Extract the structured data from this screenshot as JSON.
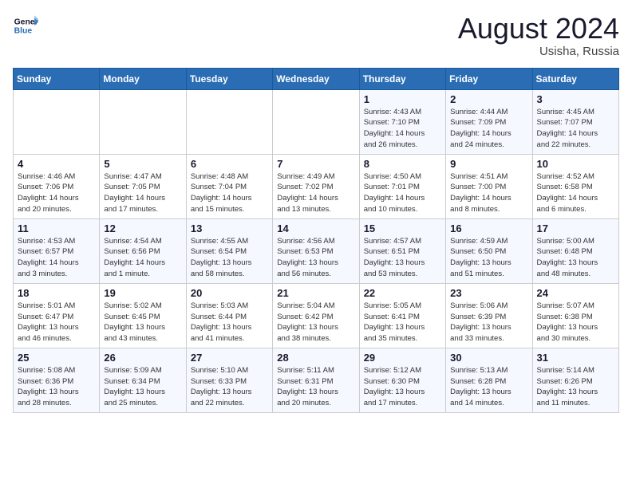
{
  "header": {
    "logo_line1": "General",
    "logo_line2": "Blue",
    "month": "August 2024",
    "location": "Usisha, Russia"
  },
  "days_of_week": [
    "Sunday",
    "Monday",
    "Tuesday",
    "Wednesday",
    "Thursday",
    "Friday",
    "Saturday"
  ],
  "weeks": [
    [
      {
        "day": "",
        "detail": ""
      },
      {
        "day": "",
        "detail": ""
      },
      {
        "day": "",
        "detail": ""
      },
      {
        "day": "",
        "detail": ""
      },
      {
        "day": "1",
        "detail": "Sunrise: 4:43 AM\nSunset: 7:10 PM\nDaylight: 14 hours\nand 26 minutes."
      },
      {
        "day": "2",
        "detail": "Sunrise: 4:44 AM\nSunset: 7:09 PM\nDaylight: 14 hours\nand 24 minutes."
      },
      {
        "day": "3",
        "detail": "Sunrise: 4:45 AM\nSunset: 7:07 PM\nDaylight: 14 hours\nand 22 minutes."
      }
    ],
    [
      {
        "day": "4",
        "detail": "Sunrise: 4:46 AM\nSunset: 7:06 PM\nDaylight: 14 hours\nand 20 minutes."
      },
      {
        "day": "5",
        "detail": "Sunrise: 4:47 AM\nSunset: 7:05 PM\nDaylight: 14 hours\nand 17 minutes."
      },
      {
        "day": "6",
        "detail": "Sunrise: 4:48 AM\nSunset: 7:04 PM\nDaylight: 14 hours\nand 15 minutes."
      },
      {
        "day": "7",
        "detail": "Sunrise: 4:49 AM\nSunset: 7:02 PM\nDaylight: 14 hours\nand 13 minutes."
      },
      {
        "day": "8",
        "detail": "Sunrise: 4:50 AM\nSunset: 7:01 PM\nDaylight: 14 hours\nand 10 minutes."
      },
      {
        "day": "9",
        "detail": "Sunrise: 4:51 AM\nSunset: 7:00 PM\nDaylight: 14 hours\nand 8 minutes."
      },
      {
        "day": "10",
        "detail": "Sunrise: 4:52 AM\nSunset: 6:58 PM\nDaylight: 14 hours\nand 6 minutes."
      }
    ],
    [
      {
        "day": "11",
        "detail": "Sunrise: 4:53 AM\nSunset: 6:57 PM\nDaylight: 14 hours\nand 3 minutes."
      },
      {
        "day": "12",
        "detail": "Sunrise: 4:54 AM\nSunset: 6:56 PM\nDaylight: 14 hours\nand 1 minute."
      },
      {
        "day": "13",
        "detail": "Sunrise: 4:55 AM\nSunset: 6:54 PM\nDaylight: 13 hours\nand 58 minutes."
      },
      {
        "day": "14",
        "detail": "Sunrise: 4:56 AM\nSunset: 6:53 PM\nDaylight: 13 hours\nand 56 minutes."
      },
      {
        "day": "15",
        "detail": "Sunrise: 4:57 AM\nSunset: 6:51 PM\nDaylight: 13 hours\nand 53 minutes."
      },
      {
        "day": "16",
        "detail": "Sunrise: 4:59 AM\nSunset: 6:50 PM\nDaylight: 13 hours\nand 51 minutes."
      },
      {
        "day": "17",
        "detail": "Sunrise: 5:00 AM\nSunset: 6:48 PM\nDaylight: 13 hours\nand 48 minutes."
      }
    ],
    [
      {
        "day": "18",
        "detail": "Sunrise: 5:01 AM\nSunset: 6:47 PM\nDaylight: 13 hours\nand 46 minutes."
      },
      {
        "day": "19",
        "detail": "Sunrise: 5:02 AM\nSunset: 6:45 PM\nDaylight: 13 hours\nand 43 minutes."
      },
      {
        "day": "20",
        "detail": "Sunrise: 5:03 AM\nSunset: 6:44 PM\nDaylight: 13 hours\nand 41 minutes."
      },
      {
        "day": "21",
        "detail": "Sunrise: 5:04 AM\nSunset: 6:42 PM\nDaylight: 13 hours\nand 38 minutes."
      },
      {
        "day": "22",
        "detail": "Sunrise: 5:05 AM\nSunset: 6:41 PM\nDaylight: 13 hours\nand 35 minutes."
      },
      {
        "day": "23",
        "detail": "Sunrise: 5:06 AM\nSunset: 6:39 PM\nDaylight: 13 hours\nand 33 minutes."
      },
      {
        "day": "24",
        "detail": "Sunrise: 5:07 AM\nSunset: 6:38 PM\nDaylight: 13 hours\nand 30 minutes."
      }
    ],
    [
      {
        "day": "25",
        "detail": "Sunrise: 5:08 AM\nSunset: 6:36 PM\nDaylight: 13 hours\nand 28 minutes."
      },
      {
        "day": "26",
        "detail": "Sunrise: 5:09 AM\nSunset: 6:34 PM\nDaylight: 13 hours\nand 25 minutes."
      },
      {
        "day": "27",
        "detail": "Sunrise: 5:10 AM\nSunset: 6:33 PM\nDaylight: 13 hours\nand 22 minutes."
      },
      {
        "day": "28",
        "detail": "Sunrise: 5:11 AM\nSunset: 6:31 PM\nDaylight: 13 hours\nand 20 minutes."
      },
      {
        "day": "29",
        "detail": "Sunrise: 5:12 AM\nSunset: 6:30 PM\nDaylight: 13 hours\nand 17 minutes."
      },
      {
        "day": "30",
        "detail": "Sunrise: 5:13 AM\nSunset: 6:28 PM\nDaylight: 13 hours\nand 14 minutes."
      },
      {
        "day": "31",
        "detail": "Sunrise: 5:14 AM\nSunset: 6:26 PM\nDaylight: 13 hours\nand 11 minutes."
      }
    ]
  ]
}
